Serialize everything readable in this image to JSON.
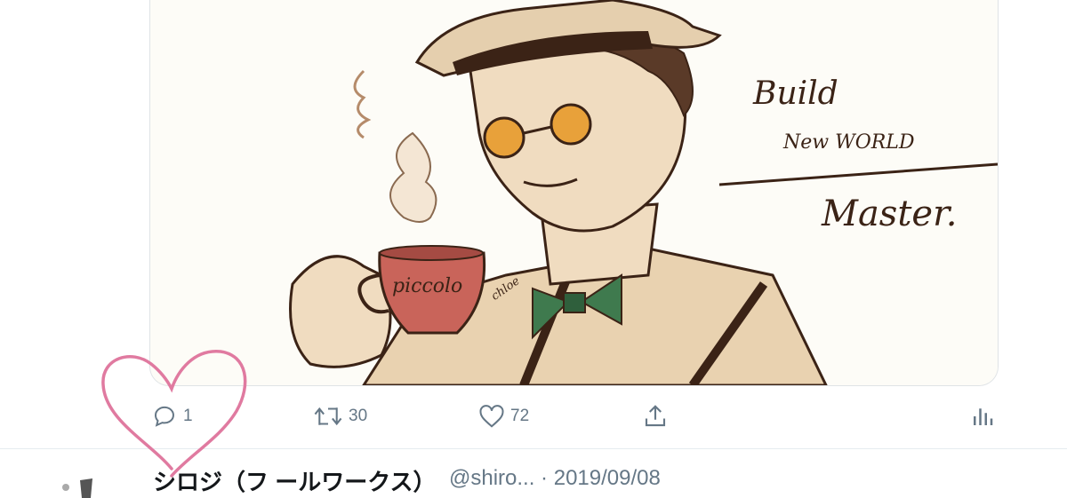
{
  "artwork": {
    "cup_text": "piccolo",
    "handwriting_line1": "Build",
    "handwriting_line2": "New WORLD",
    "handwriting_line3": "Master.",
    "signature": "chloe"
  },
  "actions": {
    "reply": {
      "icon": "reply-icon",
      "count": "1"
    },
    "retweet": {
      "icon": "retweet-icon",
      "count": "30"
    },
    "like": {
      "icon": "heart-icon",
      "count": "72"
    },
    "share": {
      "icon": "share-icon"
    },
    "analytics": {
      "icon": "analytics-icon"
    }
  },
  "next_tweet": {
    "name": "シロジ（フ ールワークス）",
    "handle": "@shiro... · 2019/09/08"
  },
  "colors": {
    "icon_gray": "#657786",
    "annotation_pink": "#e07aa0",
    "ink": "#3b2316",
    "cup_red": "#c9645a",
    "glasses_orange": "#e8a13a",
    "bowtie_green": "#3f7a4e",
    "skin": "#f0dcc0"
  }
}
